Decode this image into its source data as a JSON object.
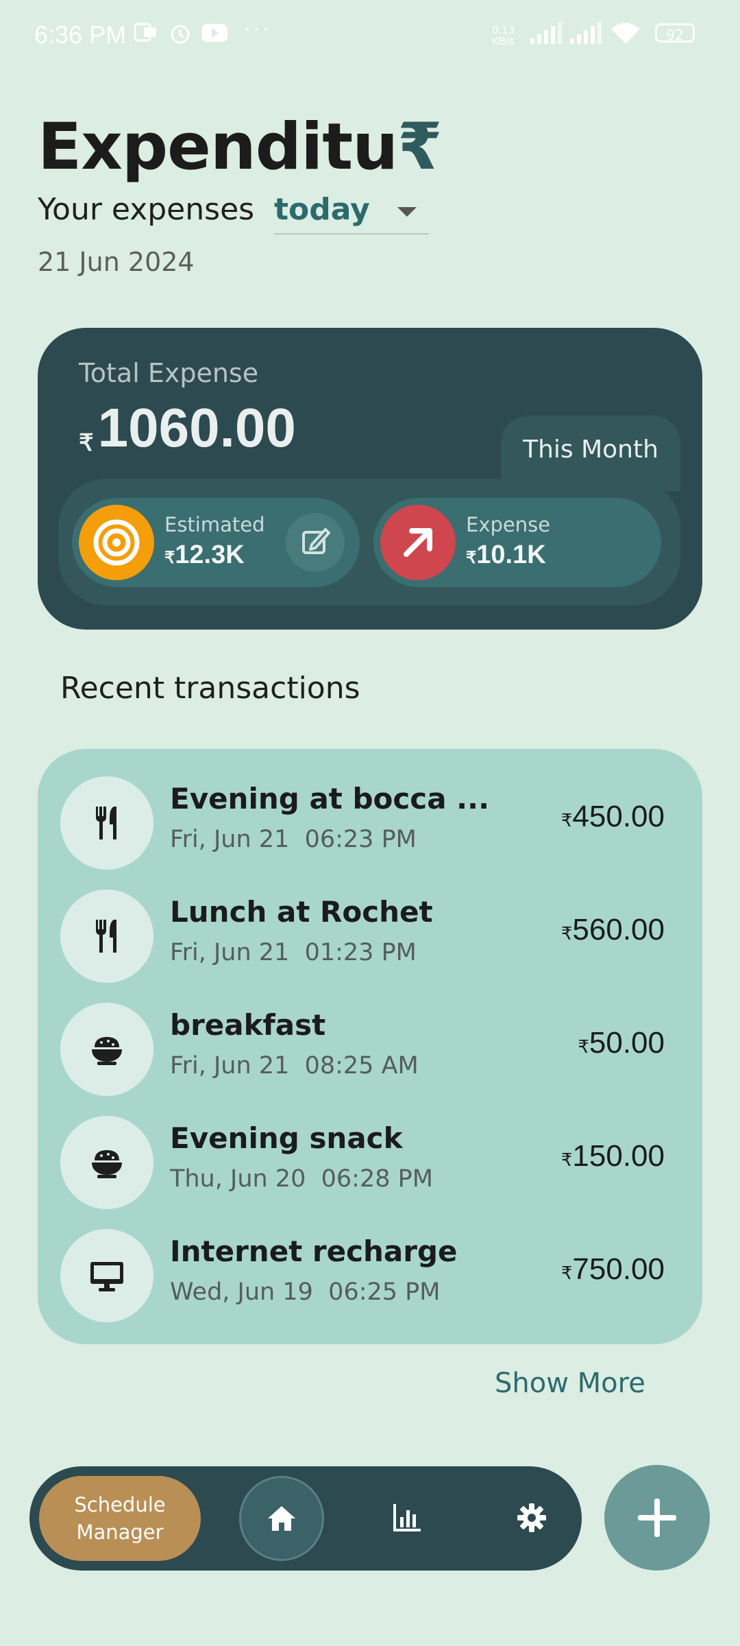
{
  "status_bar": {
    "time": "6:36 PM",
    "net_rate": "0.13",
    "net_unit": "KB/s",
    "battery": "92"
  },
  "header": {
    "title_text": "Expenditu",
    "title_rupee": "₹",
    "subtitle": "Your expenses",
    "period_selected": "today",
    "date": "21 Jun 2024"
  },
  "summary": {
    "label": "Total Expense",
    "currency": "₹",
    "total": "1060.00",
    "tab_label": "This Month",
    "estimated": {
      "label": "Estimated",
      "value": "12.3K",
      "color": "#F59E0B"
    },
    "expense": {
      "label": "Expense",
      "value": "10.1K",
      "color": "#D0464F"
    }
  },
  "recent": {
    "title": "Recent transactions",
    "items": [
      {
        "name": "Evening at bocca ...",
        "date": "Fri, Jun 21",
        "time": "06:23 PM",
        "amount": "450.00",
        "icon": "restaurant-icon"
      },
      {
        "name": "Lunch at Rochet",
        "date": "Fri, Jun 21",
        "time": "01:23 PM",
        "amount": "560.00",
        "icon": "restaurant-icon"
      },
      {
        "name": "breakfast",
        "date": "Fri, Jun 21",
        "time": "08:25 AM",
        "amount": "50.00",
        "icon": "rice-bowl-icon"
      },
      {
        "name": "Evening snack",
        "date": "Thu, Jun 20",
        "time": "06:28 PM",
        "amount": "150.00",
        "icon": "rice-bowl-icon"
      },
      {
        "name": "Internet recharge",
        "date": "Wed, Jun 19",
        "time": "06:25 PM",
        "amount": "750.00",
        "icon": "computer-icon"
      }
    ],
    "show_more": "Show More"
  },
  "nav": {
    "schedule_line1": "Schedule",
    "schedule_line2": "Manager"
  },
  "colors": {
    "background": "#DCEDE3",
    "card": "#2C4A4F",
    "list": "#A8D6CB",
    "accent": "#2D6A6C"
  }
}
